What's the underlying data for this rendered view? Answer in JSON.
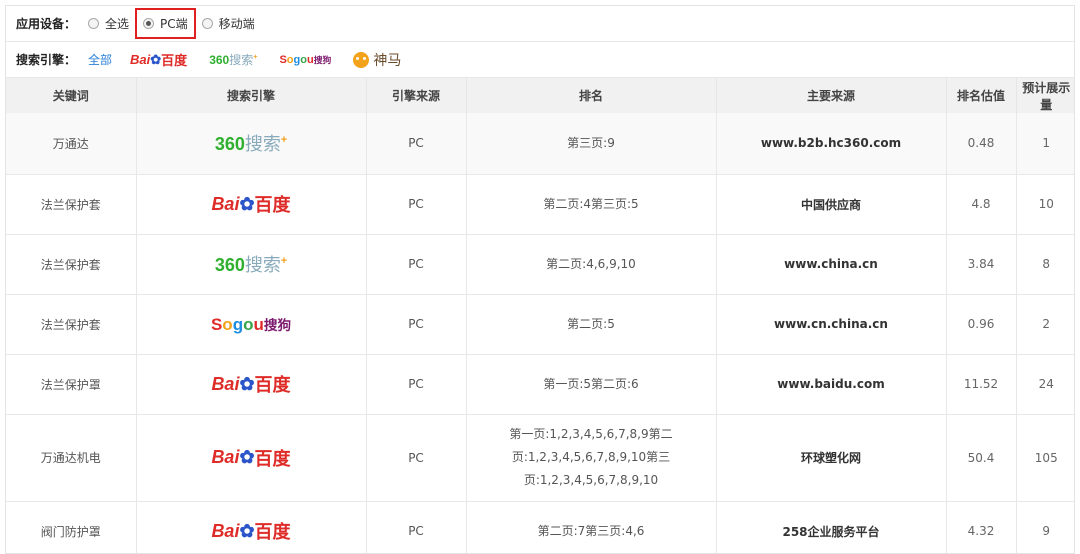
{
  "filters": {
    "device_label": "应用设备：",
    "device_options": [
      {
        "label": "全选",
        "selected": false
      },
      {
        "label": "PC端",
        "selected": true
      },
      {
        "label": "移动端",
        "selected": false
      }
    ],
    "engine_label": "搜索引擎：",
    "engine_all": "全部",
    "engines": [
      {
        "icon": "baidu-logo",
        "text": "Bai百度"
      },
      {
        "icon": "360-logo",
        "text": "360搜索"
      },
      {
        "icon": "sogou-logo",
        "text": "Sogou搜狗"
      },
      {
        "icon": "shenma-logo",
        "text": "神马"
      }
    ]
  },
  "table": {
    "headers": [
      "关键词",
      "搜索引擎",
      "引擎来源",
      "排名",
      "主要来源",
      "排名估值",
      "预计展示量"
    ],
    "rows": [
      {
        "keyword": "万通达",
        "engine": "360",
        "engine_text": "360搜索",
        "source": "PC",
        "rank": "第三页:9",
        "main_source": "www.b2b.hc360.com",
        "estimate": "0.48",
        "impressions": "1"
      },
      {
        "keyword": "法兰保护套",
        "engine": "baidu",
        "engine_text": "Bai百度",
        "source": "PC",
        "rank": "第二页:4第三页:5",
        "main_source": "中国供应商",
        "estimate": "4.8",
        "impressions": "10"
      },
      {
        "keyword": "法兰保护套",
        "engine": "360",
        "engine_text": "360搜索",
        "source": "PC",
        "rank": "第二页:4,6,9,10",
        "main_source": "www.china.cn",
        "estimate": "3.84",
        "impressions": "8"
      },
      {
        "keyword": "法兰保护套",
        "engine": "sogou",
        "engine_text": "Sogou搜狗",
        "source": "PC",
        "rank": "第二页:5",
        "main_source": "www.cn.china.cn",
        "estimate": "0.96",
        "impressions": "2"
      },
      {
        "keyword": "法兰保护罩",
        "engine": "baidu",
        "engine_text": "Bai百度",
        "source": "PC",
        "rank": "第一页:5第二页:6",
        "main_source": "www.baidu.com",
        "estimate": "11.52",
        "impressions": "24"
      },
      {
        "keyword": "万通达机电",
        "engine": "baidu",
        "engine_text": "Bai百度",
        "source": "PC",
        "rank": "第一页:1,2,3,4,5,6,7,8,9第二页:1,2,3,4,5,6,7,8,9,10第三页:1,2,3,4,5,6,7,8,9,10",
        "main_source": "环球塑化网",
        "estimate": "50.4",
        "impressions": "105"
      },
      {
        "keyword": "阀门防护罩",
        "engine": "baidu",
        "engine_text": "Bai百度",
        "source": "PC",
        "rank": "第二页:7第三页:4,6",
        "main_source": "258企业服务平台",
        "estimate": "4.32",
        "impressions": "9"
      }
    ]
  }
}
